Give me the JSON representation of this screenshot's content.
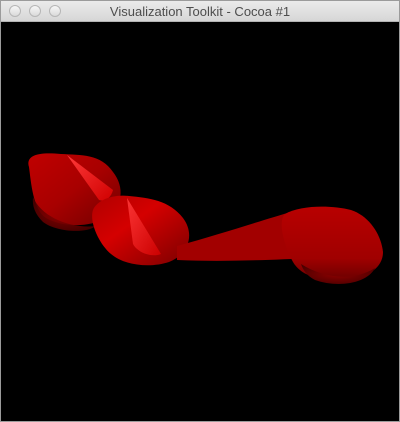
{
  "window": {
    "title": "Visualization Toolkit - Cocoa #1"
  },
  "titlebar": {
    "buttons": [
      {
        "name": "close",
        "icon": "close-icon"
      },
      {
        "name": "minimize",
        "icon": "minimize-icon"
      },
      {
        "name": "zoom",
        "icon": "zoom-icon"
      }
    ]
  },
  "viewport": {
    "background": "#000000",
    "object_color": "#cc0000",
    "object_highlight": "#ff2020",
    "object_shadow": "#800000"
  }
}
